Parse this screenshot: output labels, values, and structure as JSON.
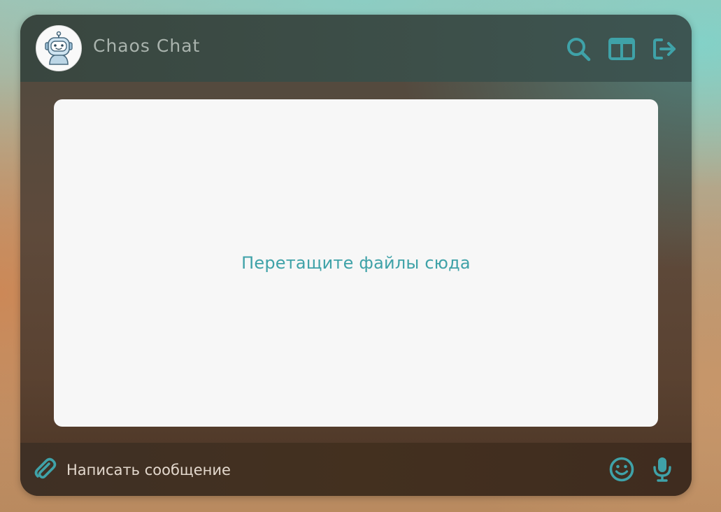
{
  "app": {
    "title": "Chaos Chat",
    "avatar_icon": "robot-icon",
    "accent_color": "#3fa2a8"
  },
  "header": {
    "actions": [
      {
        "name": "search",
        "icon": "search-icon"
      },
      {
        "name": "split-view",
        "icon": "columns-icon"
      },
      {
        "name": "logout",
        "icon": "logout-icon"
      }
    ]
  },
  "dropzone": {
    "text": "Перетащите файлы сюда"
  },
  "composer": {
    "placeholder": "Написать сообщение",
    "value": "",
    "attach_icon": "paperclip-icon",
    "emoji_icon": "smiley-icon",
    "mic_icon": "microphone-icon"
  }
}
